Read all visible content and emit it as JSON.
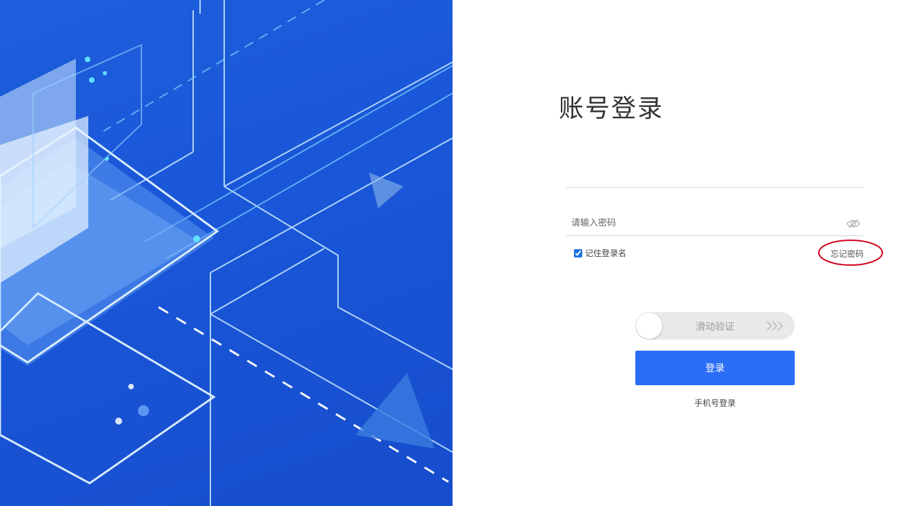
{
  "panel": {
    "title": "账号登录",
    "account": {
      "value": "",
      "placeholder": ""
    },
    "password": {
      "value": "",
      "placeholder": "请输入密码",
      "toggle_icon": "eye-slash-icon"
    },
    "remember": {
      "label": "记住登录名",
      "checked": true
    },
    "forgot_label": "忘记密码",
    "slider": {
      "label": "滑动验证",
      "arrow_icon": "triple-chevron-right-icon"
    },
    "login_label": "登录",
    "phone_login_label": "手机号登录"
  },
  "colors": {
    "hero_blue": "#1a56d8",
    "button_blue": "#2a6ef5",
    "annotation_red": "#d0021b"
  }
}
